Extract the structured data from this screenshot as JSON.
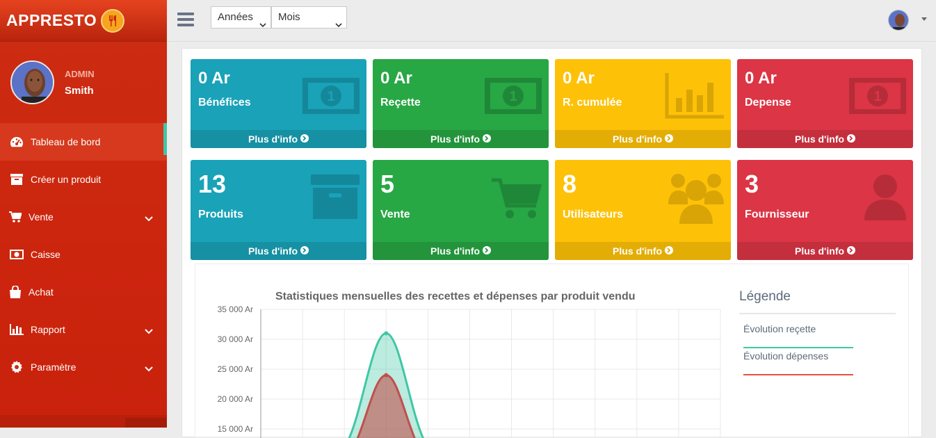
{
  "brand": {
    "name": "APPRESTO"
  },
  "user": {
    "role": "ADMIN",
    "name": "Smith"
  },
  "sidebar": {
    "items": [
      {
        "label": "Tableau de bord",
        "icon": "dashboard-icon",
        "active": true,
        "dropdown": false
      },
      {
        "label": "Créer un produit",
        "icon": "archive-icon",
        "active": false,
        "dropdown": false
      },
      {
        "label": "Vente",
        "icon": "cart-icon",
        "active": false,
        "dropdown": true
      },
      {
        "label": "Caisse",
        "icon": "money-icon",
        "active": false,
        "dropdown": false
      },
      {
        "label": "Achat",
        "icon": "shopping-bag-icon",
        "active": false,
        "dropdown": false
      },
      {
        "label": "Rapport",
        "icon": "bar-chart-icon",
        "active": false,
        "dropdown": true
      },
      {
        "label": "Paramètre",
        "icon": "gear-icon",
        "active": false,
        "dropdown": true
      }
    ]
  },
  "topbar": {
    "year_select": "Années",
    "month_select": "Mois"
  },
  "stats_row1": [
    {
      "value": "0 Ar",
      "label": "Bénéfices",
      "footer": "Plus d'info",
      "color": "#19a2b8",
      "icon": "money-bill-icon"
    },
    {
      "value": "0 Ar",
      "label": "Reçette",
      "footer": "Plus d'info",
      "color": "#28a745",
      "icon": "money-bill-icon"
    },
    {
      "value": "0 Ar",
      "label": "R. cumulée",
      "footer": "Plus d'info",
      "color": "#fdc108",
      "icon": "bar-chart-icon"
    },
    {
      "value": "0 Ar",
      "label": "Depense",
      "footer": "Plus d'info",
      "color": "#dc3545",
      "icon": "money-bill-icon"
    }
  ],
  "stats_row2": [
    {
      "value": "13",
      "label": "Produits",
      "footer": "Plus d'info",
      "color": "#19a2b8",
      "icon": "archive-icon"
    },
    {
      "value": "5",
      "label": "Vente",
      "footer": "Plus d'info",
      "color": "#28a745",
      "icon": "cart-icon"
    },
    {
      "value": "8",
      "label": "Utilisateurs",
      "footer": "Plus d'info",
      "color": "#fdc108",
      "icon": "users-icon"
    },
    {
      "value": "3",
      "label": "Fournisseur",
      "footer": "Plus d'info",
      "color": "#dc3545",
      "icon": "user-icon"
    }
  ],
  "legend": {
    "title": "Légende",
    "items": [
      {
        "label": "Évolution reçette",
        "color": "#3fc7a4"
      },
      {
        "label": "Évolution dépenses",
        "color": "#e2533a"
      }
    ]
  },
  "chart_data": {
    "type": "area",
    "title": "Statistiques mensuelles des recettes et dépenses par produit vendu",
    "y_ticks": [
      "35 000 Ar",
      "30 000 Ar",
      "25 000 Ar",
      "20 000 Ar",
      "15 000 Ar"
    ],
    "ylim": [
      15000,
      35000
    ],
    "x_count": 12,
    "series": [
      {
        "name": "Évolution reçette",
        "color": "#3fc7a4",
        "peak": {
          "x": 3,
          "y": 31000
        }
      },
      {
        "name": "Évolution dépenses",
        "color": "#c0504d",
        "peak": {
          "x": 3,
          "y": 24000
        }
      }
    ]
  }
}
